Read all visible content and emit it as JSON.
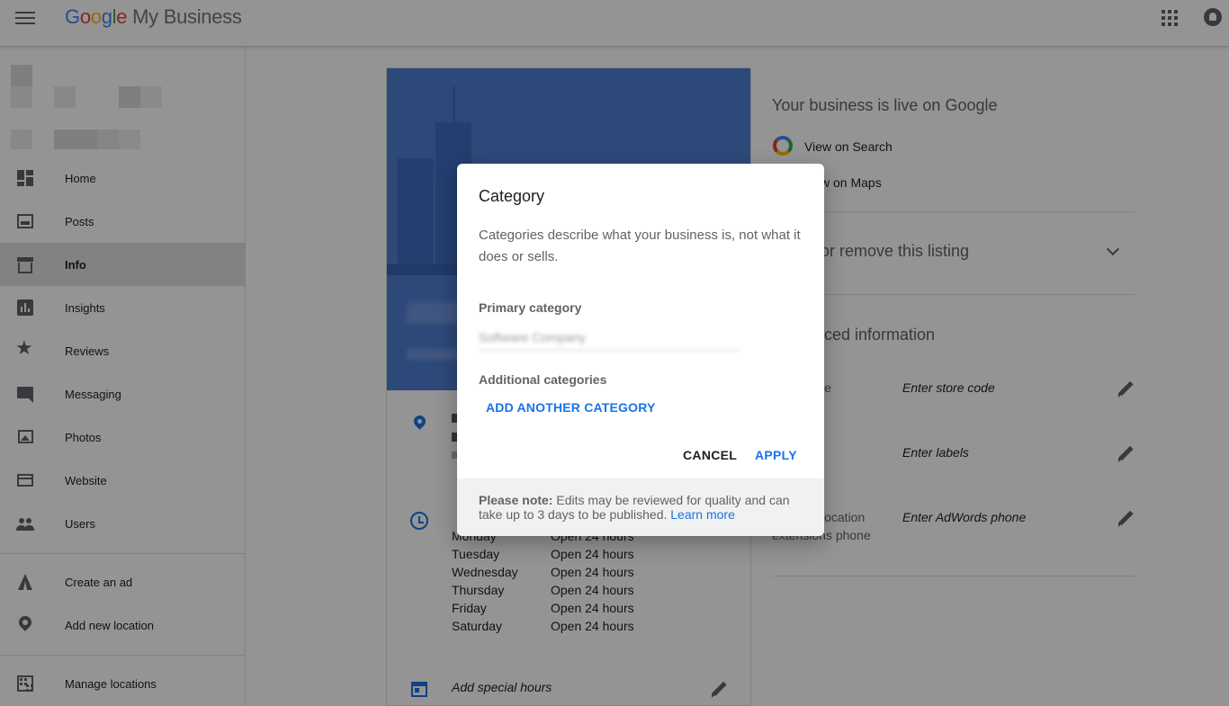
{
  "app": {
    "logo_google": [
      "G",
      "o",
      "o",
      "g",
      "l",
      "e"
    ],
    "logo_product": "My Business"
  },
  "sidebar": {
    "items": [
      {
        "label": "Home",
        "icon": "dashboard-icon"
      },
      {
        "label": "Posts",
        "icon": "posts-icon"
      },
      {
        "label": "Info",
        "icon": "store-icon",
        "active": true
      },
      {
        "label": "Insights",
        "icon": "insights-icon"
      },
      {
        "label": "Reviews",
        "icon": "star-icon"
      },
      {
        "label": "Messaging",
        "icon": "message-icon"
      },
      {
        "label": "Photos",
        "icon": "photos-icon"
      },
      {
        "label": "Website",
        "icon": "website-icon"
      },
      {
        "label": "Users",
        "icon": "users-icon"
      }
    ],
    "secondary": [
      {
        "label": "Create an ad",
        "icon": "adwords-icon"
      },
      {
        "label": "Add new location",
        "icon": "add-location-icon"
      }
    ],
    "footer": [
      {
        "label": "Manage locations",
        "icon": "building-icon"
      }
    ]
  },
  "hours": {
    "partial_top": {
      "day": "Monday",
      "value": "Open 24 hours"
    },
    "rows": [
      {
        "day": "Tuesday",
        "value": "Open 24 hours"
      },
      {
        "day": "Wednesday",
        "value": "Open 24 hours"
      },
      {
        "day": "Thursday",
        "value": "Open 24 hours"
      },
      {
        "day": "Friday",
        "value": "Open 24 hours"
      },
      {
        "day": "Saturday",
        "value": "Open 24 hours"
      }
    ],
    "partial_value": "Open 24 hours"
  },
  "special_hours": "Add special hours",
  "right_panel": {
    "live_title": "Your business is live on Google",
    "view_search": "View on Search",
    "view_maps": "w on Maps",
    "remove_listing": "or remove this listing",
    "advanced_title": "ced information",
    "store_code_label": "le",
    "store_code_value": "Enter store code",
    "labels_value": "Enter labels",
    "adwords_label_1": "location",
    "adwords_label_2": "extensions phone",
    "adwords_value": "Enter AdWords phone"
  },
  "dialog": {
    "title": "Category",
    "description": "Categories describe what your business is, not what it does or sells.",
    "primary_label": "Primary category",
    "primary_value": "Software Company",
    "additional_label": "Additional categories",
    "add_another": "ADD ANOTHER CATEGORY",
    "cancel": "CANCEL",
    "apply": "APPLY",
    "note_bold": "Please note:",
    "note_text": " Edits may be reviewed for quality and can take up to 3 days to be published. ",
    "learn_more": "Learn more"
  },
  "colors": {
    "accent": "#1a73e8",
    "cover": "#4f7ed1",
    "overlay": "rgba(0,0,0,0.42)"
  }
}
